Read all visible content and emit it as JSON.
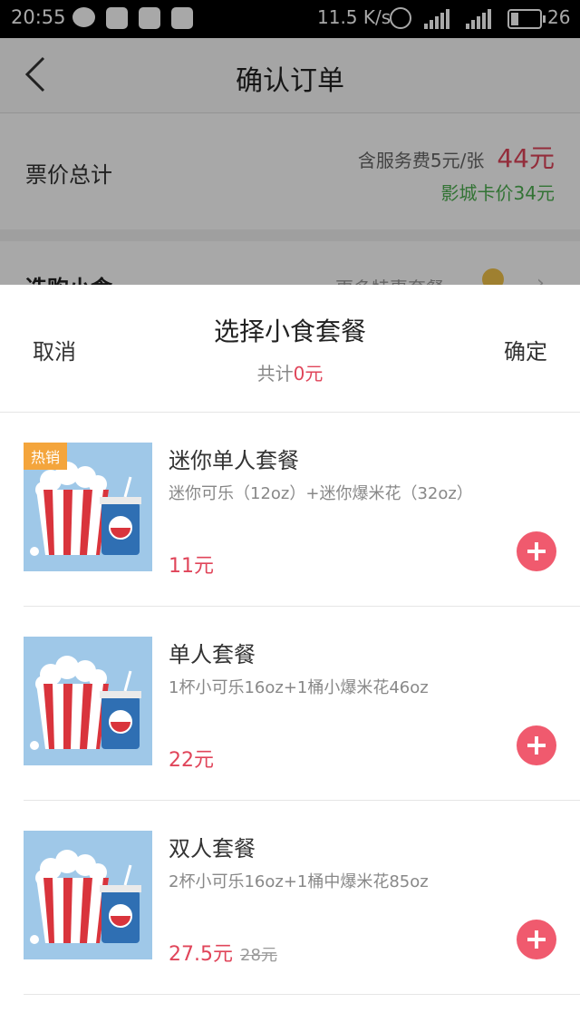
{
  "status_bar": {
    "time": "20:55",
    "speed": "11.5 K/s",
    "battery": "26",
    "battery_level": 0.26
  },
  "header": {
    "title": "确认订单"
  },
  "price": {
    "label": "票价总计",
    "service_fee": "含服务费5元/张",
    "total": "44元",
    "card_price": "影城卡价34元"
  },
  "snack_section": {
    "title": "选购小食",
    "more": "更多特惠套餐"
  },
  "sheet": {
    "cancel": "取消",
    "title": "选择小食套餐",
    "subtotal_prefix": "共计",
    "subtotal_value": "0元",
    "confirm": "确定"
  },
  "items": [
    {
      "badge": "热销",
      "name": "迷你单人套餐",
      "desc": "迷你可乐（12oz）+迷你爆米花（32oz）",
      "price": "11元",
      "orig_price": ""
    },
    {
      "badge": "",
      "name": "单人套餐",
      "desc": "1杯小可乐16oz+1桶小爆米花46oz",
      "price": "22元",
      "orig_price": ""
    },
    {
      "badge": "",
      "name": "双人套餐",
      "desc": "2杯小可乐16oz+1桶中爆米花85oz",
      "price": "27.5元",
      "orig_price": "28元"
    }
  ],
  "colors": {
    "accent": "#e0455a",
    "add_button": "#f05a6e",
    "card_price": "#4caf50",
    "hot_badge": "#f4a53c"
  }
}
